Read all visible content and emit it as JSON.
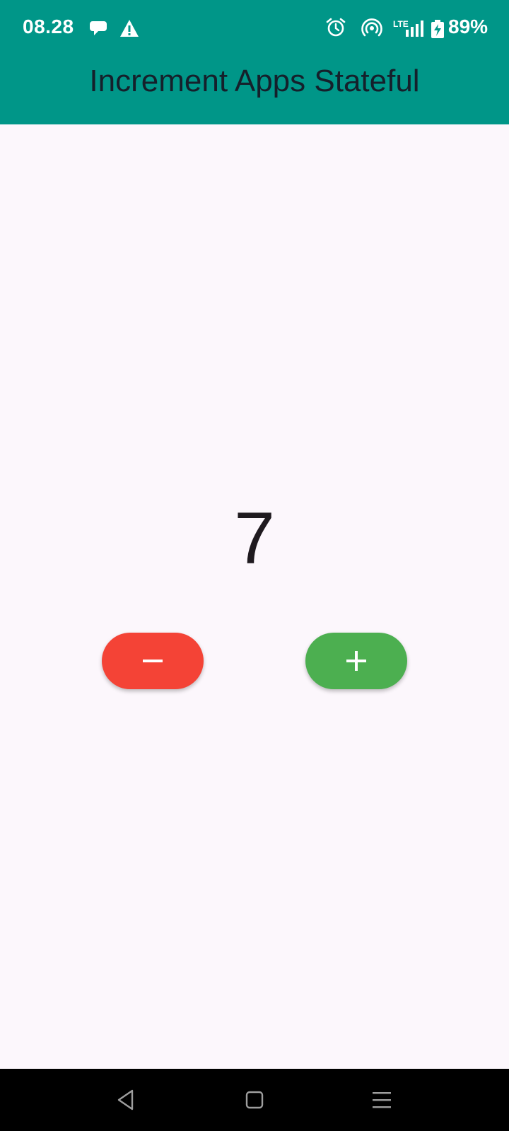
{
  "status_bar": {
    "time": "08.28",
    "network_label": "LTE",
    "battery_percent": "89%",
    "icons": [
      "chat-bubble-icon",
      "warning-icon",
      "alarm-icon",
      "hotspot-icon",
      "signal-icon",
      "battery-charging-icon"
    ]
  },
  "app_bar": {
    "title": "Increment Apps Stateful",
    "background_color": "#009688"
  },
  "counter": {
    "value": "7"
  },
  "buttons": {
    "decrement": {
      "icon": "minus-icon",
      "color": "#f44336"
    },
    "increment": {
      "icon": "plus-icon",
      "color": "#4caf50"
    }
  },
  "nav_bar": {
    "icons": [
      "back-icon",
      "home-icon",
      "menu-icon"
    ]
  },
  "colors": {
    "page_background": "#fcf7fc",
    "nav_background": "#000000"
  }
}
